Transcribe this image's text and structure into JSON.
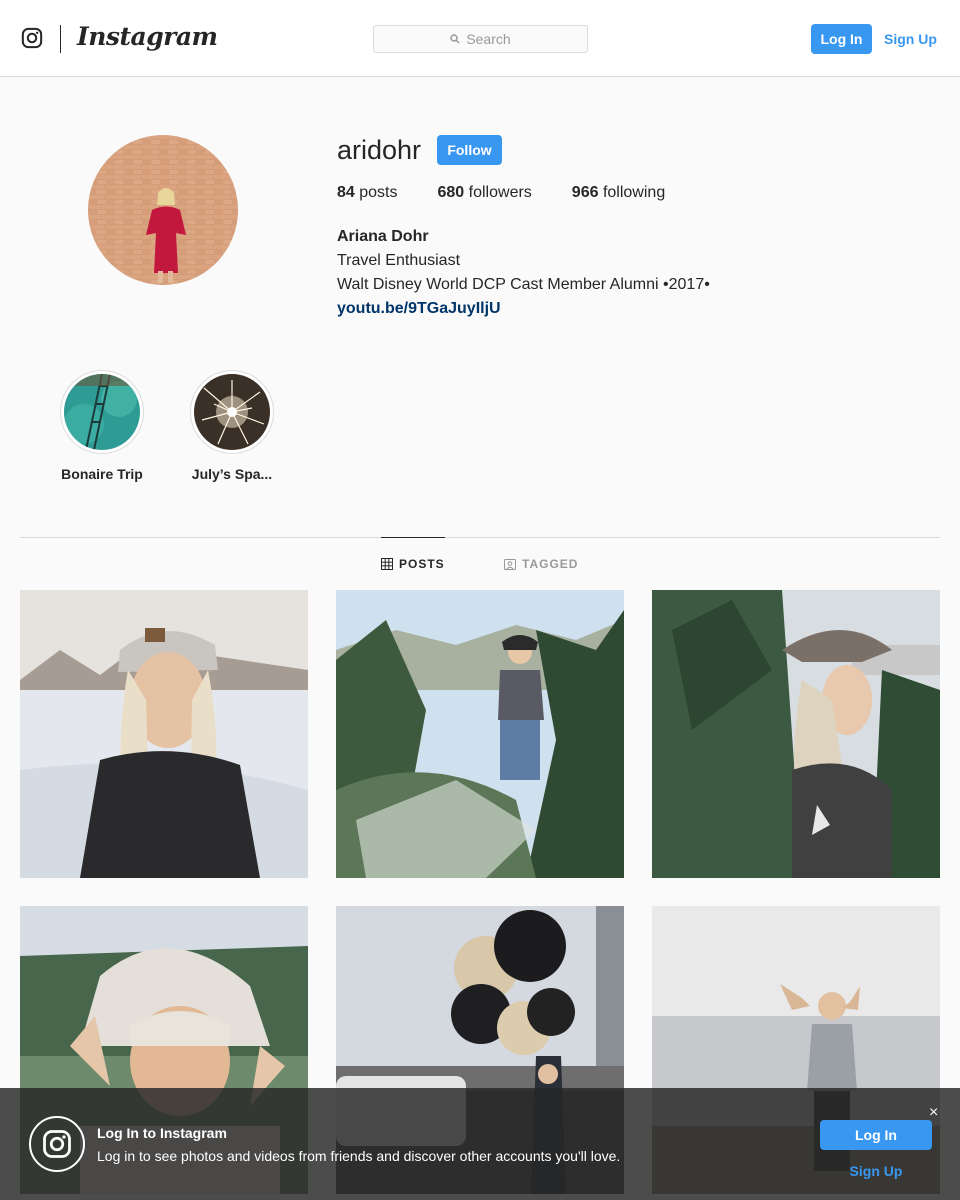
{
  "header": {
    "brand": "Instagram",
    "search_placeholder": "Search",
    "login_label": "Log In",
    "signup_label": "Sign Up"
  },
  "profile": {
    "username": "aridohr",
    "follow_label": "Follow",
    "stats": [
      {
        "value": "84",
        "label": "posts"
      },
      {
        "value": "680",
        "label": "followers"
      },
      {
        "value": "966",
        "label": "following"
      }
    ],
    "full_name": "Ariana Dohr",
    "bio_lines": [
      "Travel Enthusiast",
      "Walt Disney World DCP Cast Member Alumni •2017•"
    ],
    "link": "youtu.be/9TGaJuyIljU"
  },
  "highlights": [
    {
      "label": "Bonaire Trip"
    },
    {
      "label": "July’s Spa..."
    }
  ],
  "tabs": [
    {
      "label": "POSTS",
      "active": true
    },
    {
      "label": "TAGGED",
      "active": false
    }
  ],
  "banner": {
    "title": "Log In to Instagram",
    "text": "Log in to see photos and videos from friends and discover other accounts you'll love.",
    "close": "×",
    "login_label": "Log In",
    "signup_label": "Sign Up"
  },
  "colors": {
    "accent": "#3897f0",
    "link": "#003569",
    "border": "#dbdbdb",
    "text": "#262626"
  }
}
